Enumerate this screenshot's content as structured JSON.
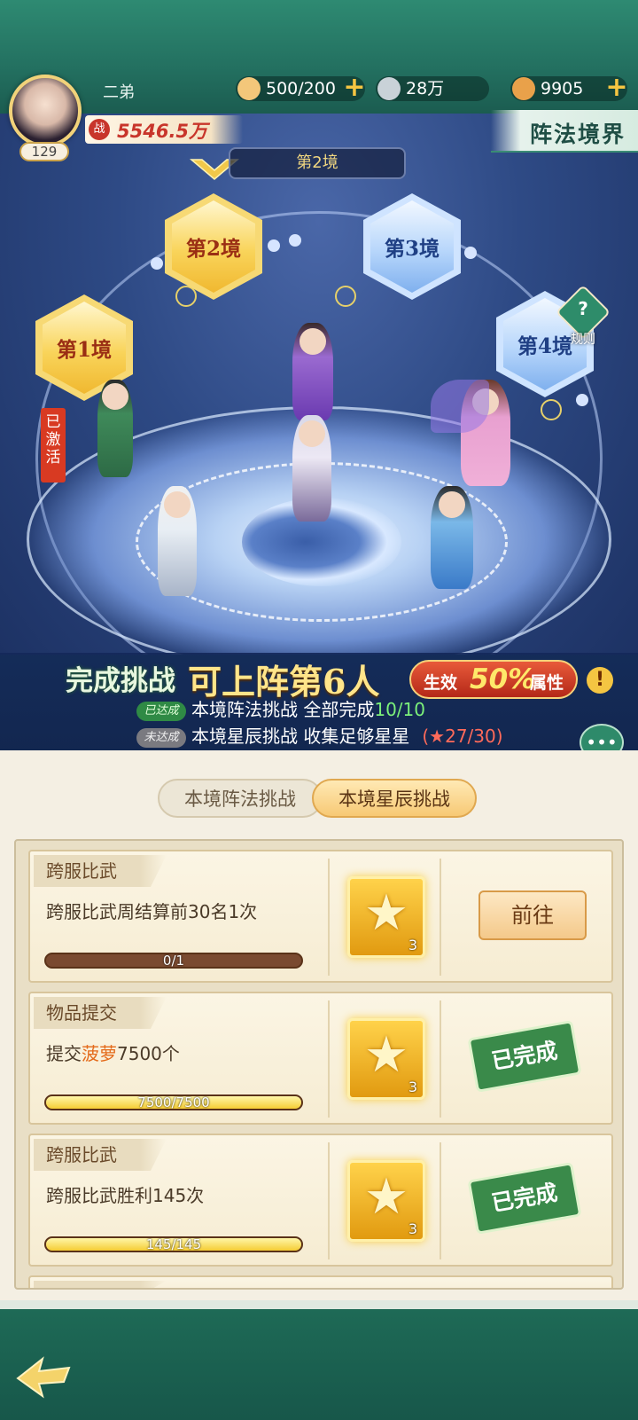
{
  "header": {
    "player_name": "二弟",
    "level": "129",
    "power": "5546.5万",
    "power_badge": "战",
    "resources": [
      {
        "name": "buns-icon",
        "value": "500/200",
        "color": "#f3c77a"
      },
      {
        "name": "coin-icon",
        "value": "28万",
        "color": "#c9d2d8"
      },
      {
        "name": "jade-icon",
        "value": "9905",
        "color": "#e9a14a"
      }
    ],
    "page_title": "阵法境界"
  },
  "scene": {
    "current_stage": "第2境",
    "rules_label": "规则",
    "activated_label": "已激活",
    "stages": [
      "第1境",
      "第2境",
      "第3境",
      "第4境"
    ]
  },
  "challenge": {
    "line1_a": "完成挑战",
    "line1_b": "可上阵第6人",
    "effect_a": "生效",
    "effect_pct": "50%",
    "effect_b": "属性",
    "row1_tag": "已达成",
    "row1_text": "本境阵法挑战 全部完成",
    "row1_progress": "10/10",
    "row2_tag": "未达成",
    "row2_text": "本境星辰挑战 收集足够星星",
    "row2_progress": "(★27/30)"
  },
  "tabs": {
    "formation": "本境阵法挑战",
    "stars": "本境星辰挑战"
  },
  "tasks": [
    {
      "title": "跨服比武",
      "desc": "跨服比武周结算前30名1次",
      "desc_hl": "",
      "desc_tail": "",
      "progress": "0/1",
      "fraction": 0,
      "reward_qty": "3",
      "action": "前往"
    },
    {
      "title": "物品提交",
      "desc": "提交",
      "desc_hl": "菠萝",
      "desc_tail": "7500个",
      "progress": "7500/7500",
      "fraction": 1,
      "reward_qty": "3",
      "action": "已完成"
    },
    {
      "title": "跨服比武",
      "desc": "跨服比武胜利145次",
      "desc_hl": "",
      "desc_tail": "",
      "progress": "145/145",
      "fraction": 1,
      "reward_qty": "3",
      "action": "已完成"
    }
  ]
}
